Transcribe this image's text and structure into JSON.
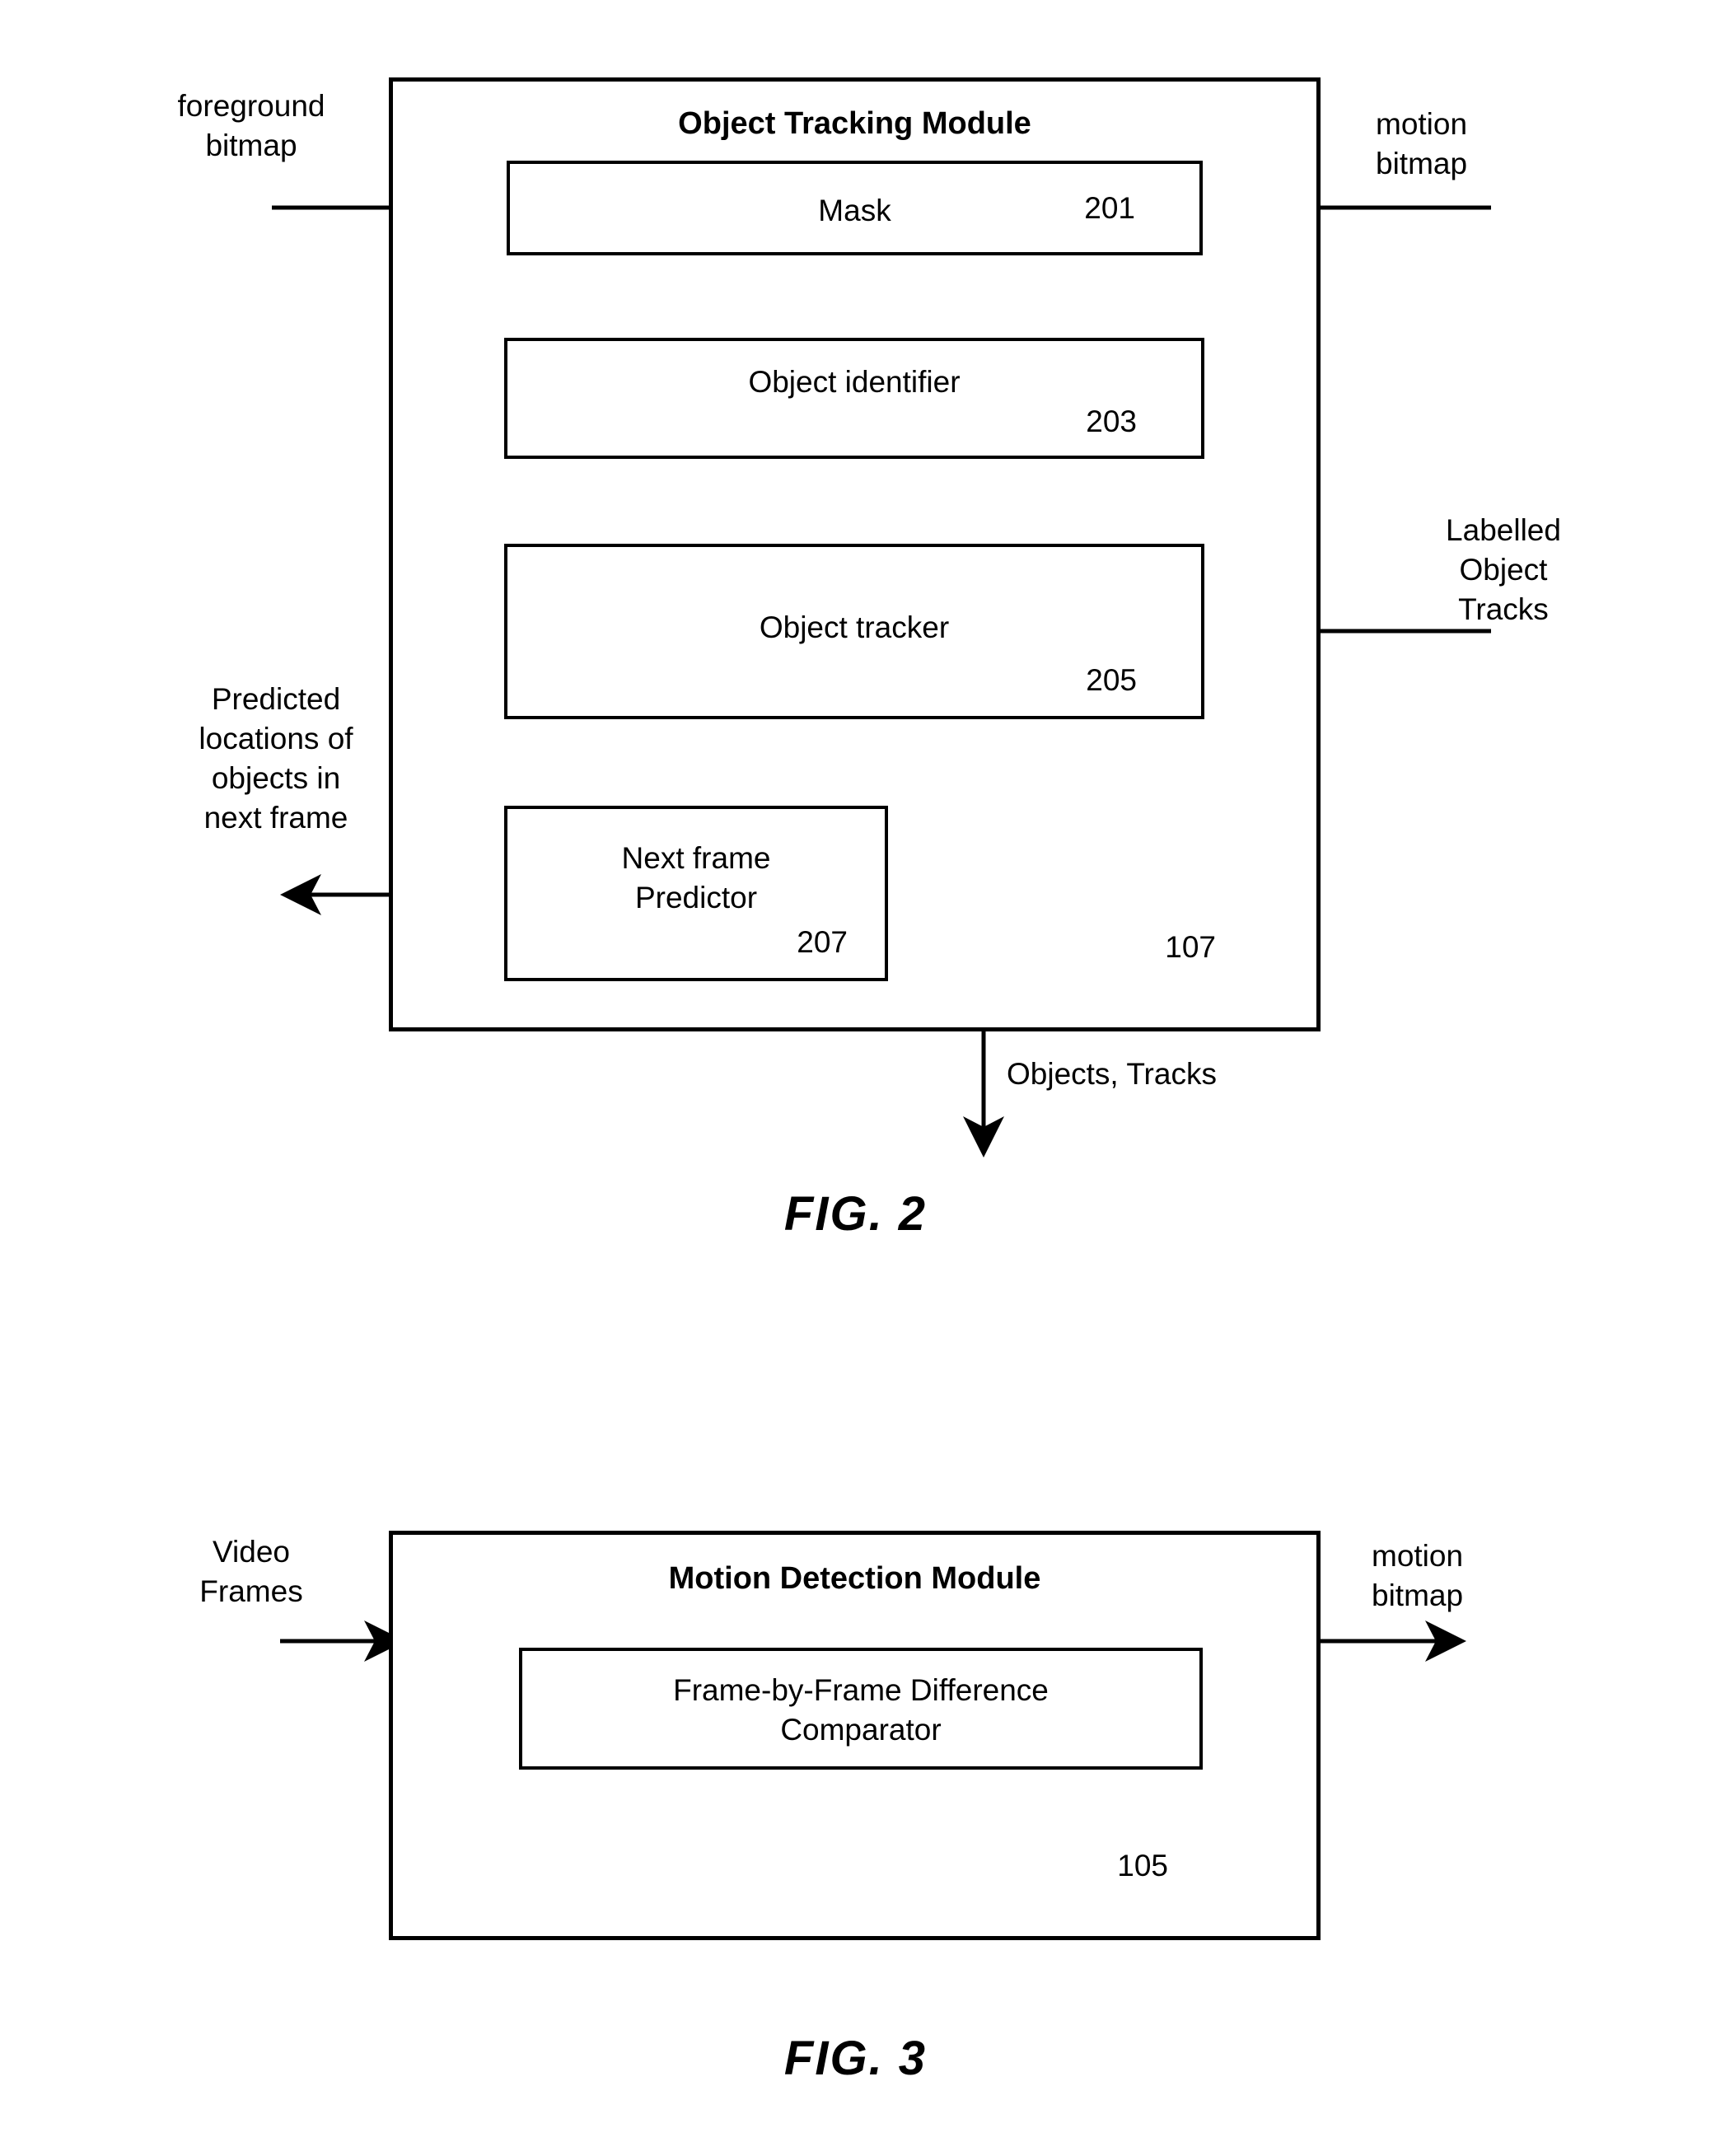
{
  "figure2": {
    "caption": "FIG. 2",
    "module": {
      "title": "Object Tracking Module",
      "ref": "107"
    },
    "inputs": {
      "foreground_bitmap": "foreground\nbitmap",
      "motion_bitmap": "motion\nbitmap",
      "labelled_object_tracks": "Labelled\nObject\nTracks"
    },
    "outputs": {
      "predicted_locations": "Predicted\nlocations of\nobjects in\nnext frame",
      "objects_tracks": "Objects, Tracks"
    },
    "blocks": [
      {
        "label": "Mask",
        "ref": "201"
      },
      {
        "label": "Object identifier",
        "ref": "203"
      },
      {
        "label": "Object tracker",
        "ref": "205"
      },
      {
        "label": "Next frame\nPredictor",
        "ref": "207"
      }
    ]
  },
  "figure3": {
    "caption": "FIG. 3",
    "module": {
      "title": "Motion Detection Module",
      "ref": "105"
    },
    "inputs": {
      "video_frames": "Video\nFrames"
    },
    "outputs": {
      "motion_bitmap": "motion\nbitmap"
    },
    "blocks": [
      {
        "label": "Frame-by-Frame Difference\nComparator"
      }
    ]
  },
  "colors": {
    "ink": "#000000",
    "paper": "#ffffff"
  }
}
